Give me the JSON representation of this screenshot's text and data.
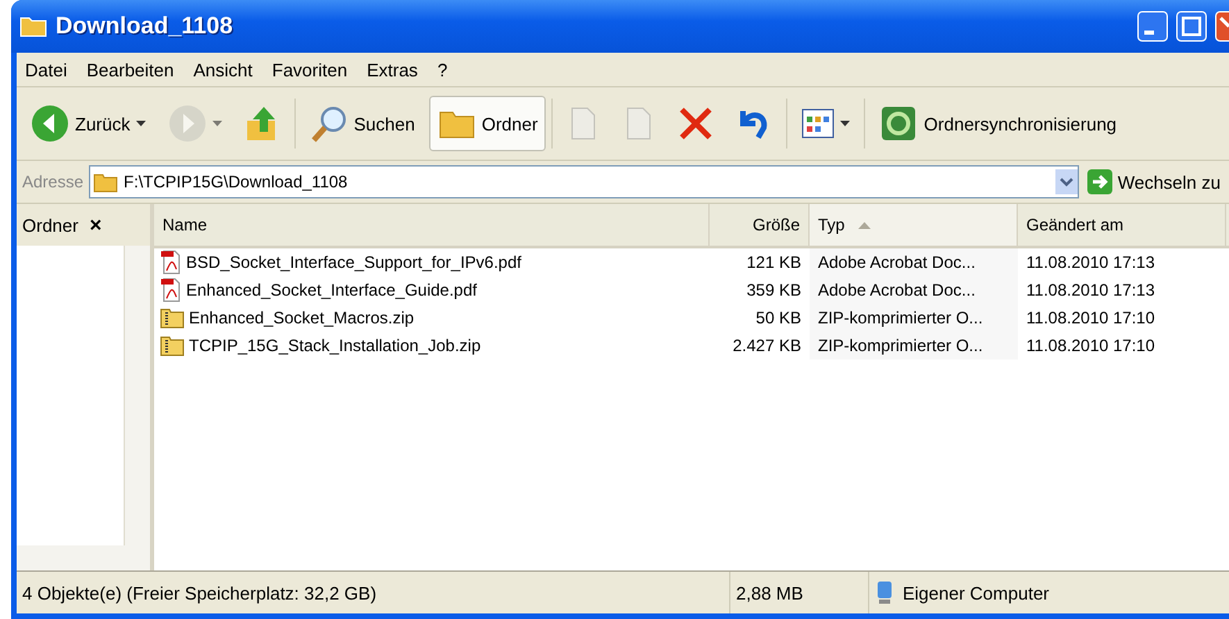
{
  "window": {
    "title": "Download_1108"
  },
  "menu": [
    "Datei",
    "Bearbeiten",
    "Ansicht",
    "Favoriten",
    "Extras",
    "?"
  ],
  "toolbar": [
    {
      "kind": "back",
      "label": "Zurück",
      "disabled": false,
      "pressed": false
    },
    {
      "kind": "forward",
      "disabled": true,
      "pressed": false
    },
    {
      "kind": "up",
      "disabled": false,
      "pressed": false
    },
    {
      "kind": "search",
      "label": "Suchen",
      "disabled": false,
      "pressed": false
    },
    {
      "kind": "folders",
      "label": "Ordner",
      "disabled": false,
      "pressed": true
    },
    {
      "kind": "move",
      "disabled": true,
      "pressed": false
    },
    {
      "kind": "copy",
      "disabled": true,
      "pressed": false
    },
    {
      "kind": "delete",
      "disabled": false,
      "pressed": false
    },
    {
      "kind": "undo",
      "disabled": false,
      "pressed": false
    },
    {
      "kind": "views",
      "disabled": false,
      "pressed": false
    },
    {
      "kind": "sync",
      "label": "Ordnersynchronisierung",
      "disabled": false,
      "pressed": false
    }
  ],
  "address": {
    "label": "Adresse",
    "value": "F:\\TCPIP15G\\Download_1108",
    "go": "Wechseln zu"
  },
  "folders_pane": {
    "title": "Ordner",
    "close": "×"
  },
  "table": {
    "columns": [
      {
        "label": "Name",
        "sorted": false
      },
      {
        "label": "Größe",
        "sorted": false
      },
      {
        "label": "Typ",
        "sorted": true
      },
      {
        "label": "Geändert am",
        "sorted": false
      }
    ],
    "rows": [
      {
        "kind": "pdf",
        "name": "BSD_Socket_Interface_Support_for_IPv6.pdf",
        "size": "121 KB",
        "type": "Adobe Acrobat Doc...",
        "modified": "11.08.2010 17:13"
      },
      {
        "kind": "pdf",
        "name": "Enhanced_Socket_Interface_Guide.pdf",
        "size": "359 KB",
        "type": "Adobe Acrobat Doc...",
        "modified": "11.08.2010 17:13"
      },
      {
        "kind": "zip",
        "name": "Enhanced_Socket_Macros.zip",
        "size": "50 KB",
        "type": "ZIP-komprimierter O...",
        "modified": "11.08.2010 17:10"
      },
      {
        "kind": "zip",
        "name": "TCPIP_15G_Stack_Installation_Job.zip",
        "size": "2.427 KB",
        "type": "ZIP-komprimierter O...",
        "modified": "11.08.2010 17:10"
      }
    ]
  },
  "status_bar": {
    "objects": "4 Objekte(e) (Freier Speicherplatz: 32,2 GB)",
    "size": "2,88 MB",
    "location": "Eigener Computer"
  }
}
